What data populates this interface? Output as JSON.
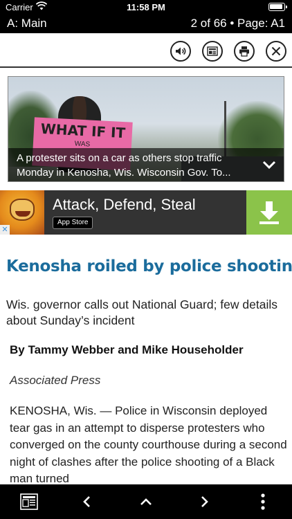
{
  "status_bar": {
    "carrier": "Carrier",
    "time": "11:58 PM"
  },
  "nav": {
    "section": "A: Main",
    "page_info": "2 of 66 • Page: A1"
  },
  "toolbar": {
    "buttons": [
      "speaker-icon",
      "article-view-icon",
      "print-icon",
      "close-icon"
    ]
  },
  "hero": {
    "sign_text": "WHAT IF IT",
    "sign_subtext": "WAS",
    "caption_line1": "A protester sits on a car as others stop traffic",
    "caption_line2": "Monday in Kenosha, Wis. Wisconsin Gov. To..."
  },
  "ad": {
    "title": "Attack, Defend, Steal",
    "store_badge": "App Store",
    "close_mark": "✕"
  },
  "article": {
    "headline": "Kenosha roiled by police shooting",
    "deck": "Wis. governor calls out National Guard; few details about Sunday’s incident",
    "byline": "By Tammy Webber and Mike Householder",
    "agency": "Associated Press",
    "body": "KENOSHA, Wis. — Police in Wisconsin deployed tear gas in an attempt to disperse protesters who converged on the county courthouse during a second night of clashes after the police shooting of a Black man turned"
  },
  "bottom_bar": {
    "buttons": [
      "page-thumbnails-icon",
      "previous-icon",
      "up-icon",
      "next-icon",
      "more-icon"
    ]
  },
  "colors": {
    "headline": "#1b6c9c",
    "bars": "#000000",
    "ad_download": "#8bc34a"
  }
}
